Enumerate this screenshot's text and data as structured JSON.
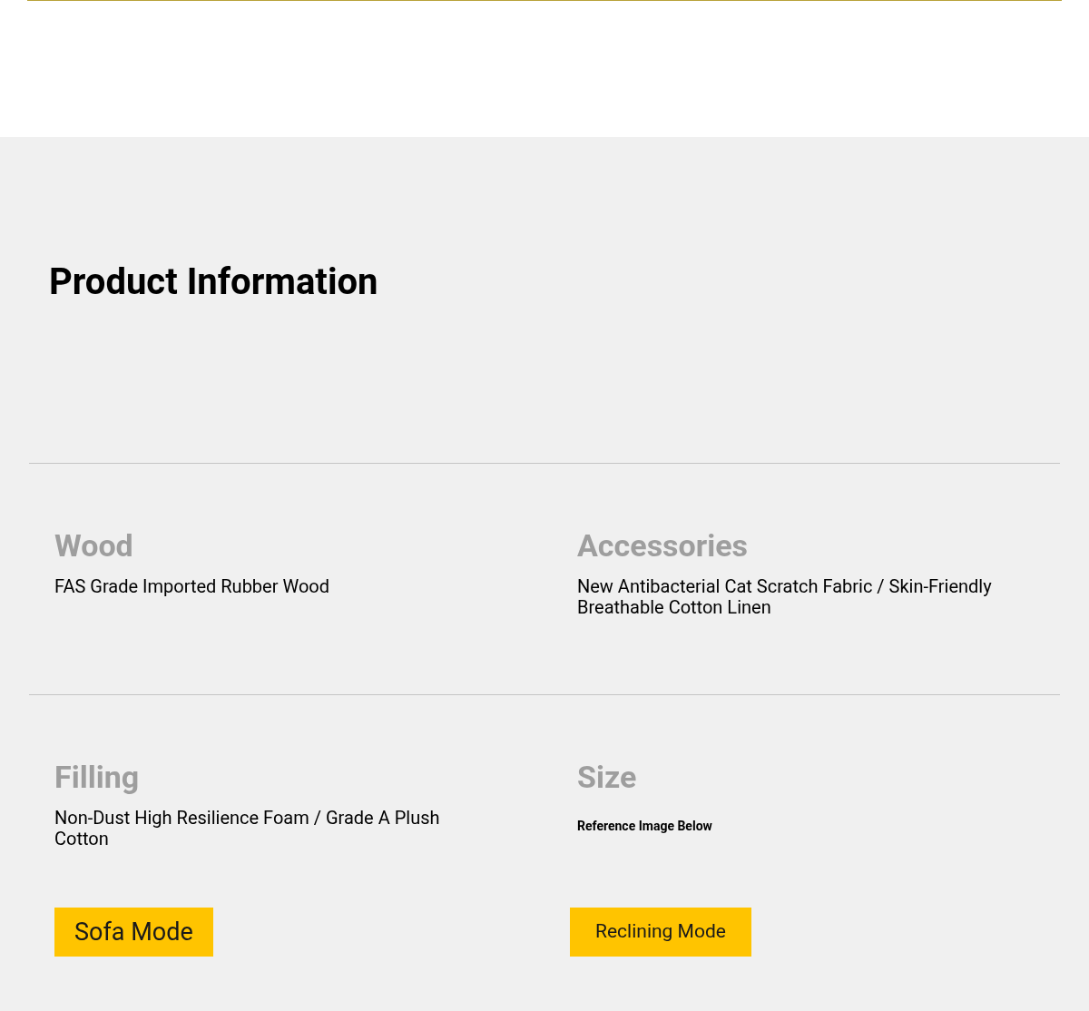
{
  "heading": "Product Information",
  "specs": [
    {
      "label": "Wood",
      "value": "FAS Grade Imported Rubber Wood"
    },
    {
      "label": "Accessories",
      "value": "New Antibacterial Cat Scratch Fabric / Skin-Friendly Breathable Cotton Linen"
    },
    {
      "label": "Filling",
      "value": "Non-Dust High Resilience Foam / Grade A Plush Cotton"
    },
    {
      "label": "Size",
      "value": "Reference Image Below",
      "kind": "small"
    }
  ],
  "modes": [
    "Sofa Mode",
    "Reclining Mode"
  ]
}
